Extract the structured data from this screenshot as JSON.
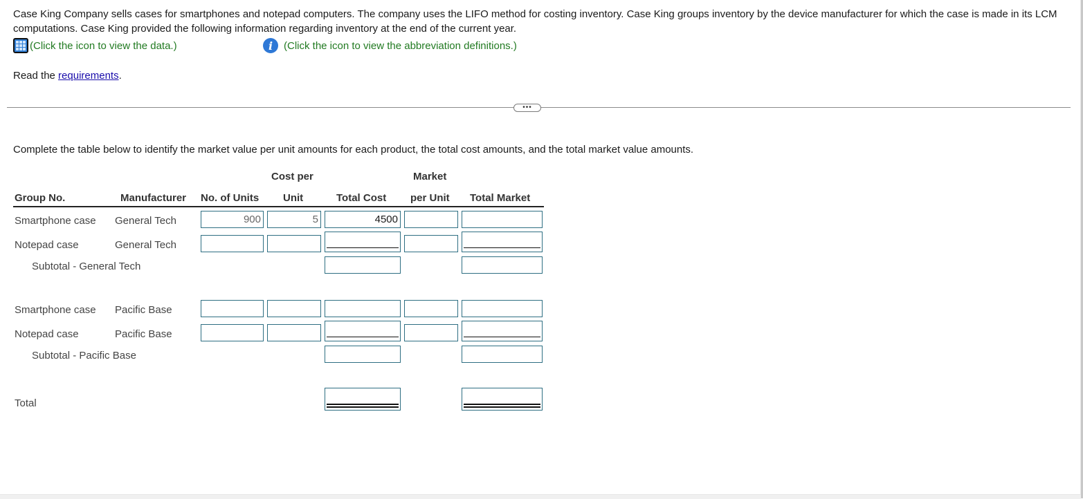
{
  "problem": {
    "intro_text": "Case King Company sells cases for smartphones and notepad computers. The company uses the LIFO method for costing inventory. Case King groups inventory by the device manufacturer for which the case is made in its LCM computations. Case King provided the following information regarding inventory at the end of the current year.",
    "data_link_text": "(Click the icon to view the data.)",
    "abbreviation_link_text": "(Click the icon to view the abbreviation definitions.)",
    "read_prefix": "Read the ",
    "requirements_link": "requirements",
    "read_suffix": ".",
    "expand_button": "•••",
    "instruction": "Complete the table below to identify the market value per unit amounts for each product, the total cost amounts, and the total market value amounts."
  },
  "table": {
    "headers": {
      "group_no": "Group No.",
      "manufacturer": "Manufacturer",
      "units": "No. of Units",
      "cost_per_top": "Cost per",
      "cost_per_bottom": "Unit",
      "total_cost": "Total Cost",
      "market_top": "Market",
      "market_bottom": "per Unit",
      "total_market": "Total Market"
    },
    "rows": [
      {
        "group": "Smartphone case",
        "manufacturer": "General Tech",
        "units": "900",
        "cost_per_unit": "5",
        "total_cost": "4500",
        "market_per_unit": "",
        "total_market": ""
      },
      {
        "group": "Notepad case",
        "manufacturer": "General Tech",
        "units": "",
        "cost_per_unit": "",
        "total_cost": "",
        "market_per_unit": "",
        "total_market": ""
      },
      {
        "group": "Smartphone case",
        "manufacturer": "Pacific Base",
        "units": "",
        "cost_per_unit": "",
        "total_cost": "",
        "market_per_unit": "",
        "total_market": ""
      },
      {
        "group": "Notepad case",
        "manufacturer": "Pacific Base",
        "units": "",
        "cost_per_unit": "",
        "total_cost": "",
        "market_per_unit": "",
        "total_market": ""
      }
    ],
    "subtotals": [
      {
        "label": "Subtotal - General Tech",
        "total_cost": "",
        "total_market": ""
      },
      {
        "label": "Subtotal - Pacific Base",
        "total_cost": "",
        "total_market": ""
      }
    ],
    "total": {
      "label": "Total",
      "total_cost": "",
      "total_market": ""
    }
  },
  "colors": {
    "link_green": "#217a21",
    "link_blue": "#1a0dab",
    "input_border": "#2d6e82",
    "icon_blue": "#2e78d6"
  }
}
